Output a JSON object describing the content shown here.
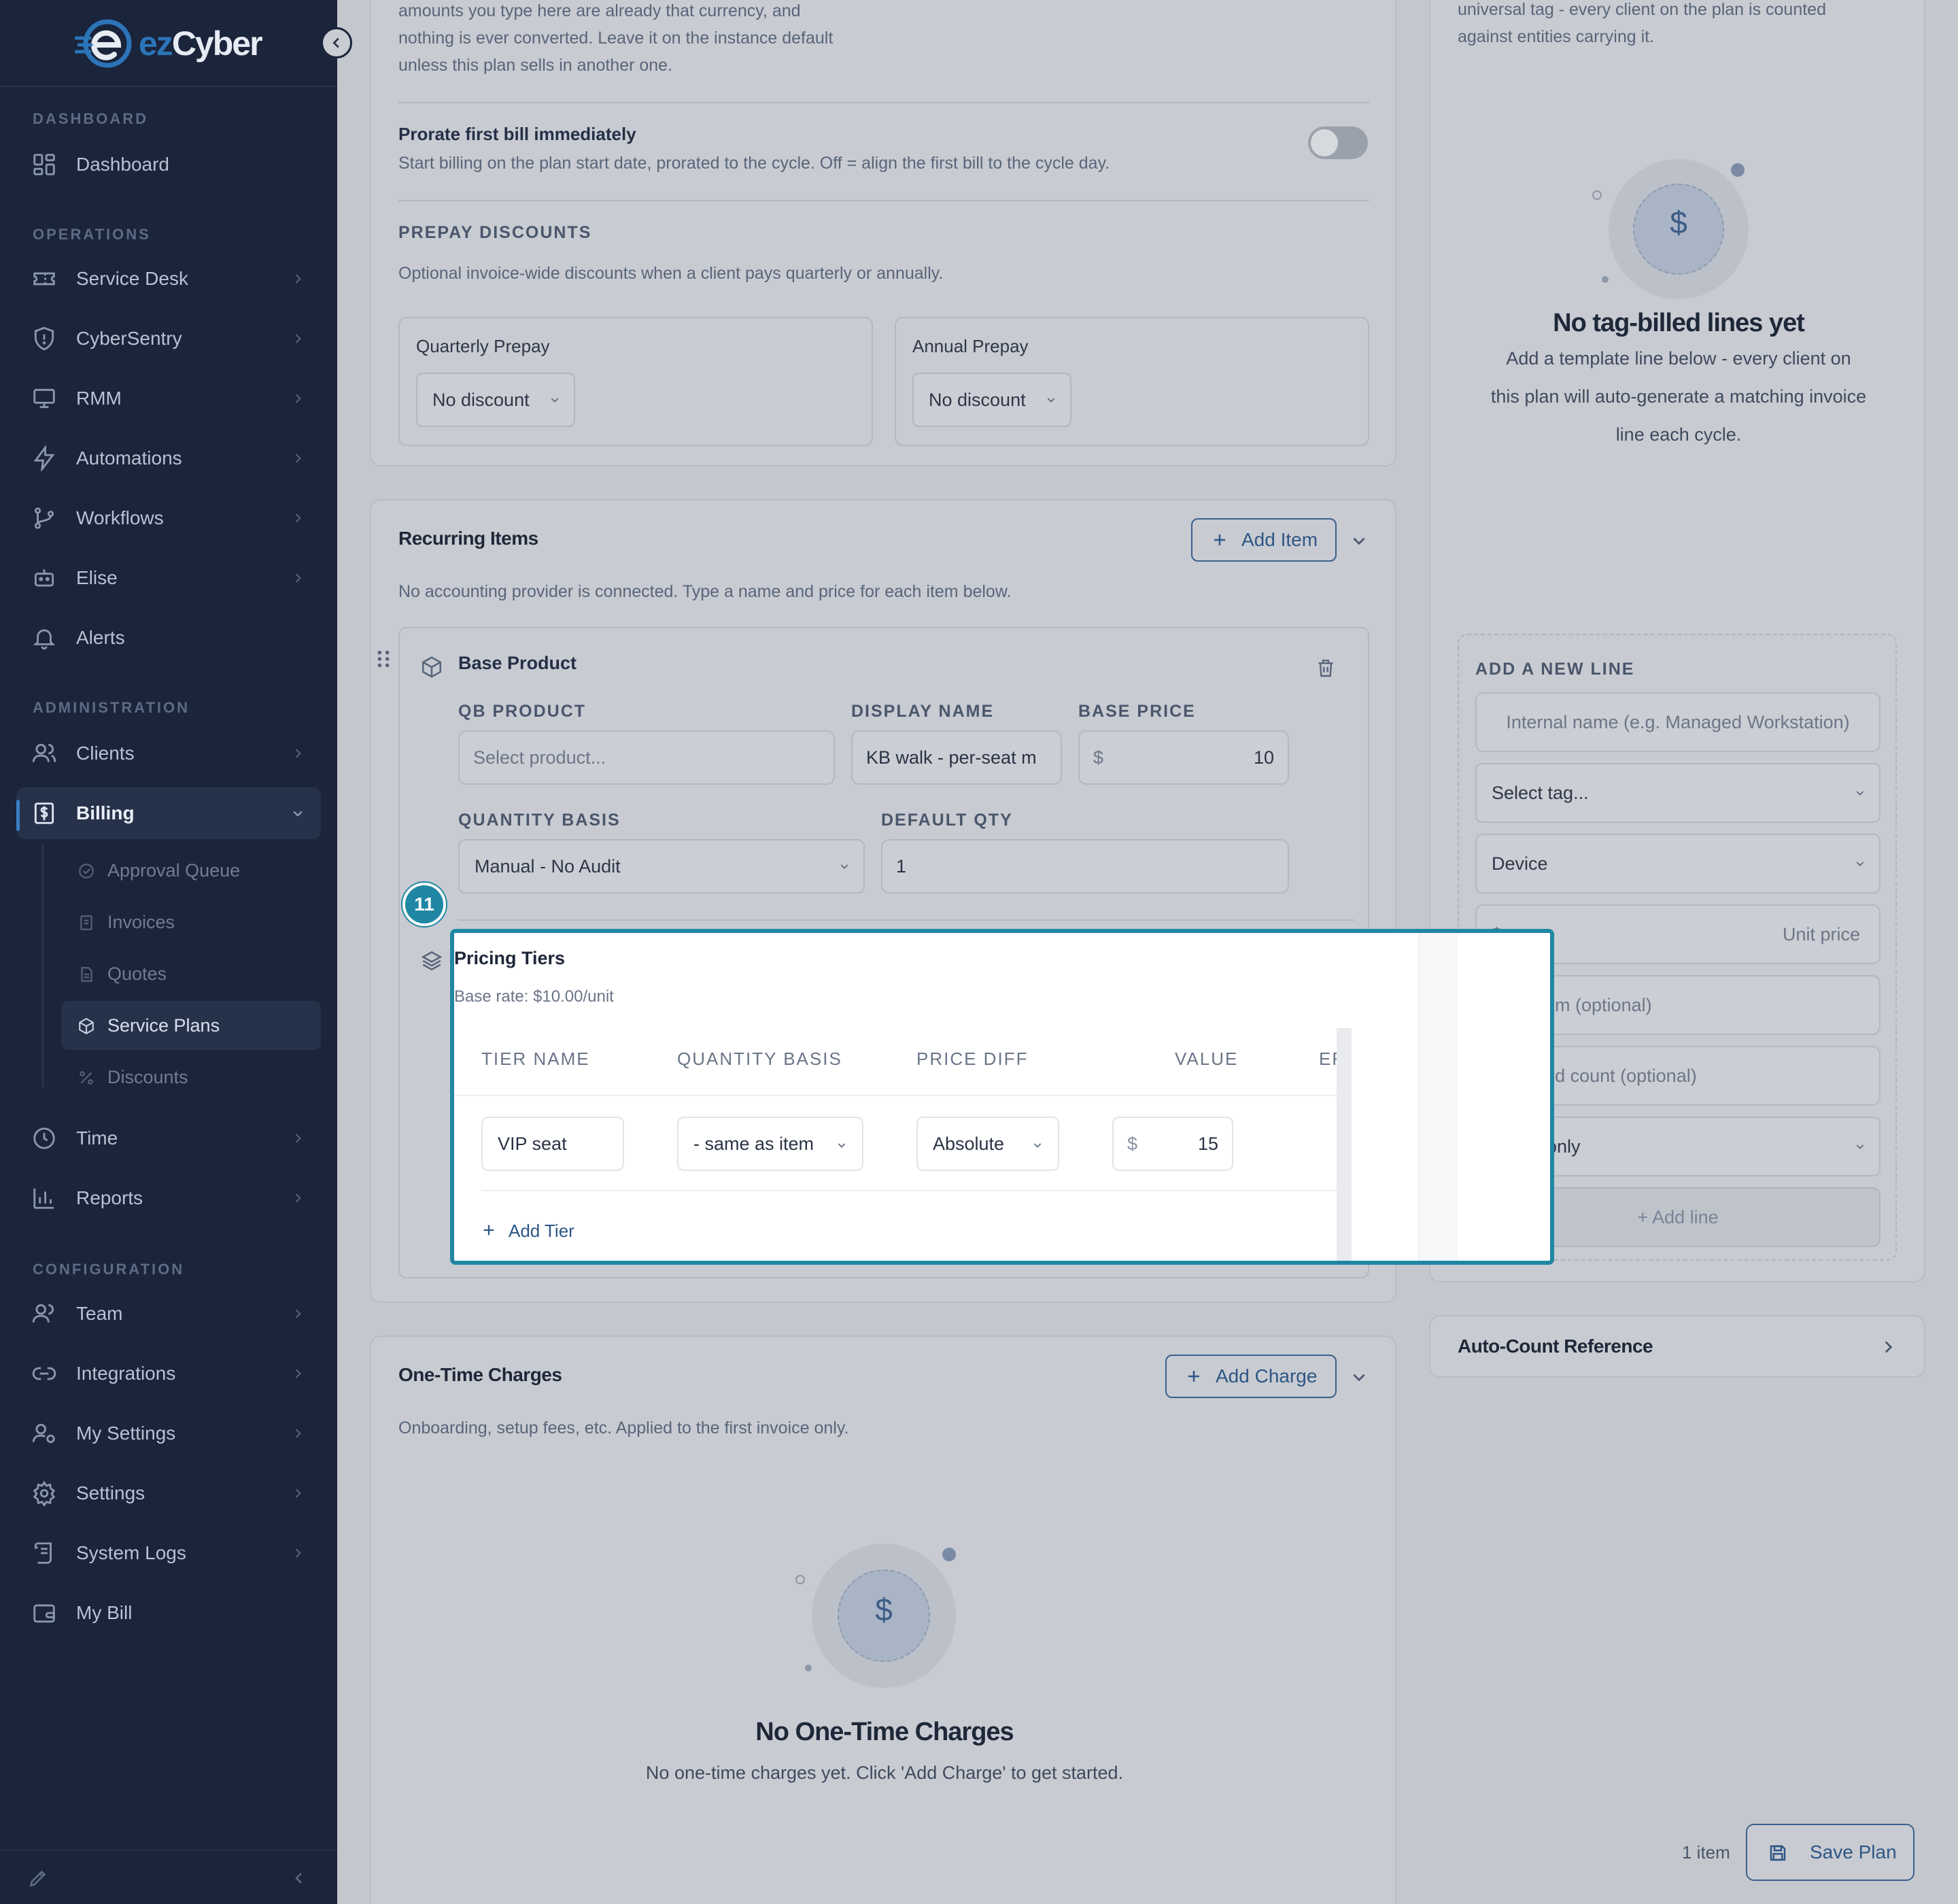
{
  "brand": {
    "part1": "ez",
    "part2": "Cyber"
  },
  "sidebar": {
    "sections": {
      "dashboard": "DASHBOARD",
      "operations": "OPERATIONS",
      "administration": "ADMINISTRATION",
      "configuration": "CONFIGURATION"
    },
    "items": {
      "dashboard": "Dashboard",
      "service_desk": "Service Desk",
      "cybersentry": "CyberSentry",
      "rmm": "RMM",
      "automations": "Automations",
      "workflows": "Workflows",
      "elise": "Elise",
      "alerts": "Alerts",
      "clients": "Clients",
      "billing": "Billing",
      "time": "Time",
      "reports": "Reports",
      "team": "Team",
      "integrations": "Integrations",
      "my_settings": "My Settings",
      "settings": "Settings",
      "system_logs": "System Logs",
      "my_bill": "My Bill"
    },
    "billing_sub": {
      "approval_queue": "Approval Queue",
      "invoices": "Invoices",
      "quotes": "Quotes",
      "service_plans": "Service Plans",
      "discounts": "Discounts"
    }
  },
  "settings_card": {
    "currency_note_l1": "amounts you type here are already that currency, and",
    "currency_note_l2": "nothing is ever converted. Leave it on the instance default",
    "currency_note_l3": "unless this plan sells in another one.",
    "prorate_title": "Prorate first bill immediately",
    "prorate_desc": "Start billing on the plan start date, prorated to the cycle. Off = align the first bill to the cycle day.",
    "prorate_on": false,
    "prepay_caption": "PREPAY DISCOUNTS",
    "prepay_desc": "Optional invoice-wide discounts when a client pays quarterly or annually.",
    "quarterly_label": "Quarterly Prepay",
    "quarterly_value": "No discount",
    "annual_label": "Annual Prepay",
    "annual_value": "No discount"
  },
  "recurring": {
    "title": "Recurring Items",
    "add_label": "Add Item",
    "note": "No accounting provider is connected. Type a name and price for each item below.",
    "item": {
      "title": "Base Product",
      "qb_caption": "QB PRODUCT",
      "qb_placeholder": "Select product...",
      "display_caption": "DISPLAY NAME",
      "display_value": "KB walk - per-seat m",
      "price_caption": "BASE PRICE",
      "currency": "$",
      "price_value": "10",
      "qty_basis_caption": "QUANTITY BASIS",
      "qty_basis_value": "Manual - No Audit",
      "default_qty_caption": "DEFAULT QTY",
      "default_qty_value": "1"
    }
  },
  "tiers": {
    "step_number": "11",
    "title": "Pricing Tiers",
    "base_rate": "Base rate: $10.00/unit",
    "columns": [
      "TIER NAME",
      "QUANTITY BASIS",
      "PRICE DIFF",
      "VALUE",
      "EF"
    ],
    "row": {
      "name": "VIP seat",
      "basis": "- same as item",
      "diff": "Absolute",
      "currency": "$",
      "value": "15",
      "effective": "$"
    },
    "add_tier": "Add Tier"
  },
  "one_time": {
    "title": "One-Time Charges",
    "add_label": "Add Charge",
    "note": "Onboarding, setup fees, etc. Applied to the first invoice only.",
    "empty_title": "No One-Time Charges",
    "empty_desc": "No one-time charges yet. Click 'Add Charge' to get started."
  },
  "tag_billing": {
    "top_note_l1": "universal tag - every client on the plan is counted",
    "top_note_l2": "against entities carrying it.",
    "empty_title": "No tag-billed lines yet",
    "empty_desc_l1": "Add a template line below - every client on",
    "empty_desc_l2": "this plan will auto-generate a matching invoice",
    "empty_desc_l3": "line each cycle.",
    "add_caption": "ADD A NEW LINE",
    "internal_placeholder": "Internal name (e.g. Managed Workstation)",
    "tag_select": "Select tag...",
    "entity_select": "Device",
    "currency": "$",
    "unit_price_placeholder": "Unit price",
    "minimum_placeholder": "Minimum (optional)",
    "included_placeholder": "Included count (optional)",
    "status_select": "Active only",
    "add_line": "Add line"
  },
  "auto_count": {
    "title": "Auto-Count Reference"
  },
  "footer": {
    "count": "1 item",
    "save": "Save Plan"
  },
  "colors": {
    "accent": "#1f87a4",
    "sidebar_bg": "#1a243a",
    "brand_blue": "#2c74b8"
  }
}
